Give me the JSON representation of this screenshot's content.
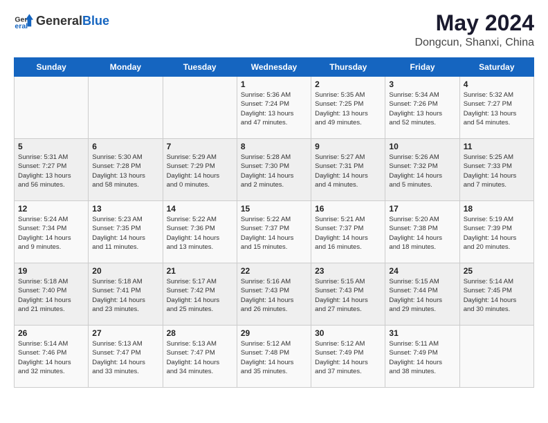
{
  "header": {
    "logo_general": "General",
    "logo_blue": "Blue",
    "month_year": "May 2024",
    "location": "Dongcun, Shanxi, China"
  },
  "weekdays": [
    "Sunday",
    "Monday",
    "Tuesday",
    "Wednesday",
    "Thursday",
    "Friday",
    "Saturday"
  ],
  "weeks": [
    [
      {
        "day": "",
        "info": ""
      },
      {
        "day": "",
        "info": ""
      },
      {
        "day": "",
        "info": ""
      },
      {
        "day": "1",
        "info": "Sunrise: 5:36 AM\nSunset: 7:24 PM\nDaylight: 13 hours\nand 47 minutes."
      },
      {
        "day": "2",
        "info": "Sunrise: 5:35 AM\nSunset: 7:25 PM\nDaylight: 13 hours\nand 49 minutes."
      },
      {
        "day": "3",
        "info": "Sunrise: 5:34 AM\nSunset: 7:26 PM\nDaylight: 13 hours\nand 52 minutes."
      },
      {
        "day": "4",
        "info": "Sunrise: 5:32 AM\nSunset: 7:27 PM\nDaylight: 13 hours\nand 54 minutes."
      }
    ],
    [
      {
        "day": "5",
        "info": "Sunrise: 5:31 AM\nSunset: 7:27 PM\nDaylight: 13 hours\nand 56 minutes."
      },
      {
        "day": "6",
        "info": "Sunrise: 5:30 AM\nSunset: 7:28 PM\nDaylight: 13 hours\nand 58 minutes."
      },
      {
        "day": "7",
        "info": "Sunrise: 5:29 AM\nSunset: 7:29 PM\nDaylight: 14 hours\nand 0 minutes."
      },
      {
        "day": "8",
        "info": "Sunrise: 5:28 AM\nSunset: 7:30 PM\nDaylight: 14 hours\nand 2 minutes."
      },
      {
        "day": "9",
        "info": "Sunrise: 5:27 AM\nSunset: 7:31 PM\nDaylight: 14 hours\nand 4 minutes."
      },
      {
        "day": "10",
        "info": "Sunrise: 5:26 AM\nSunset: 7:32 PM\nDaylight: 14 hours\nand 5 minutes."
      },
      {
        "day": "11",
        "info": "Sunrise: 5:25 AM\nSunset: 7:33 PM\nDaylight: 14 hours\nand 7 minutes."
      }
    ],
    [
      {
        "day": "12",
        "info": "Sunrise: 5:24 AM\nSunset: 7:34 PM\nDaylight: 14 hours\nand 9 minutes."
      },
      {
        "day": "13",
        "info": "Sunrise: 5:23 AM\nSunset: 7:35 PM\nDaylight: 14 hours\nand 11 minutes."
      },
      {
        "day": "14",
        "info": "Sunrise: 5:22 AM\nSunset: 7:36 PM\nDaylight: 14 hours\nand 13 minutes."
      },
      {
        "day": "15",
        "info": "Sunrise: 5:22 AM\nSunset: 7:37 PM\nDaylight: 14 hours\nand 15 minutes."
      },
      {
        "day": "16",
        "info": "Sunrise: 5:21 AM\nSunset: 7:37 PM\nDaylight: 14 hours\nand 16 minutes."
      },
      {
        "day": "17",
        "info": "Sunrise: 5:20 AM\nSunset: 7:38 PM\nDaylight: 14 hours\nand 18 minutes."
      },
      {
        "day": "18",
        "info": "Sunrise: 5:19 AM\nSunset: 7:39 PM\nDaylight: 14 hours\nand 20 minutes."
      }
    ],
    [
      {
        "day": "19",
        "info": "Sunrise: 5:18 AM\nSunset: 7:40 PM\nDaylight: 14 hours\nand 21 minutes."
      },
      {
        "day": "20",
        "info": "Sunrise: 5:18 AM\nSunset: 7:41 PM\nDaylight: 14 hours\nand 23 minutes."
      },
      {
        "day": "21",
        "info": "Sunrise: 5:17 AM\nSunset: 7:42 PM\nDaylight: 14 hours\nand 25 minutes."
      },
      {
        "day": "22",
        "info": "Sunrise: 5:16 AM\nSunset: 7:43 PM\nDaylight: 14 hours\nand 26 minutes."
      },
      {
        "day": "23",
        "info": "Sunrise: 5:15 AM\nSunset: 7:43 PM\nDaylight: 14 hours\nand 27 minutes."
      },
      {
        "day": "24",
        "info": "Sunrise: 5:15 AM\nSunset: 7:44 PM\nDaylight: 14 hours\nand 29 minutes."
      },
      {
        "day": "25",
        "info": "Sunrise: 5:14 AM\nSunset: 7:45 PM\nDaylight: 14 hours\nand 30 minutes."
      }
    ],
    [
      {
        "day": "26",
        "info": "Sunrise: 5:14 AM\nSunset: 7:46 PM\nDaylight: 14 hours\nand 32 minutes."
      },
      {
        "day": "27",
        "info": "Sunrise: 5:13 AM\nSunset: 7:47 PM\nDaylight: 14 hours\nand 33 minutes."
      },
      {
        "day": "28",
        "info": "Sunrise: 5:13 AM\nSunset: 7:47 PM\nDaylight: 14 hours\nand 34 minutes."
      },
      {
        "day": "29",
        "info": "Sunrise: 5:12 AM\nSunset: 7:48 PM\nDaylight: 14 hours\nand 35 minutes."
      },
      {
        "day": "30",
        "info": "Sunrise: 5:12 AM\nSunset: 7:49 PM\nDaylight: 14 hours\nand 37 minutes."
      },
      {
        "day": "31",
        "info": "Sunrise: 5:11 AM\nSunset: 7:49 PM\nDaylight: 14 hours\nand 38 minutes."
      },
      {
        "day": "",
        "info": ""
      }
    ]
  ]
}
